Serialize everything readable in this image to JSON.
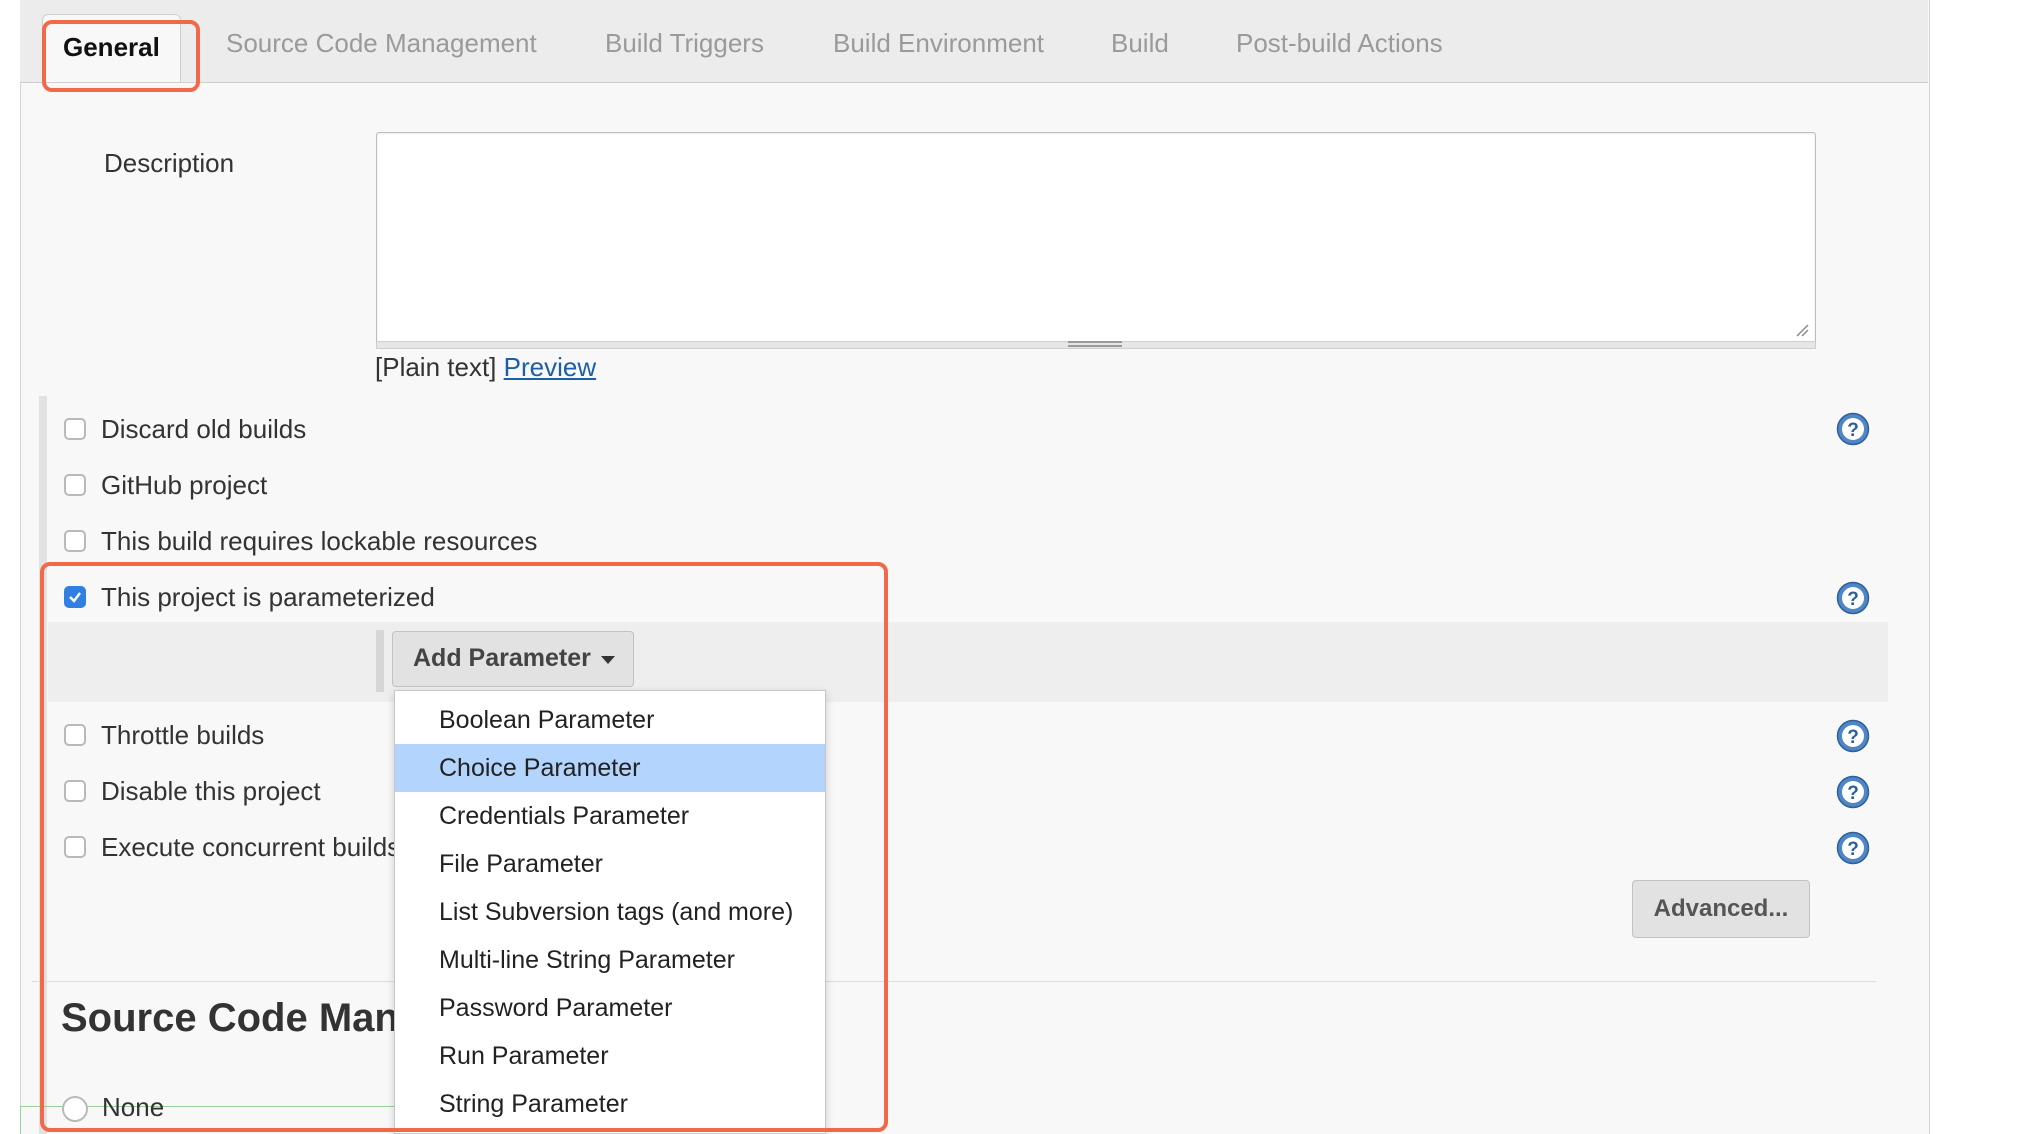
{
  "tabs": [
    {
      "label": "General",
      "active": true
    },
    {
      "label": "Source Code Management"
    },
    {
      "label": "Build Triggers"
    },
    {
      "label": "Build Environment"
    },
    {
      "label": "Build"
    },
    {
      "label": "Post-build Actions"
    }
  ],
  "description": {
    "label": "Description",
    "value": "",
    "format_text": "[Plain text]",
    "preview_link": "Preview"
  },
  "options": [
    {
      "label": "Discard old builds",
      "checked": false,
      "help": true
    },
    {
      "label": "GitHub project",
      "checked": false,
      "help": false
    },
    {
      "label": "This build requires lockable resources",
      "checked": false,
      "help": false
    },
    {
      "label": "This project is parameterized",
      "checked": true,
      "help": true
    },
    {
      "label": "Throttle builds",
      "checked": false,
      "help": true
    },
    {
      "label": "Disable this project",
      "checked": false,
      "help": true
    },
    {
      "label": "Execute concurrent builds",
      "checked": false,
      "help": true
    }
  ],
  "add_parameter": {
    "label": "Add Parameter",
    "menu": [
      "Boolean Parameter",
      "Choice Parameter",
      "Credentials Parameter",
      "File Parameter",
      "List Subversion tags (and more)",
      "Multi-line String Parameter",
      "Password Parameter",
      "Run Parameter",
      "String Parameter"
    ],
    "selected": "Choice Parameter"
  },
  "advanced_button": "Advanced...",
  "scm_section": {
    "title": "Source Code Man",
    "first_option": "None"
  },
  "colors": {
    "highlight": "#f06a4a",
    "checkbox_checked": "#2f80e0",
    "menu_selected": "#b3d4fc",
    "link": "#1c5fa8"
  }
}
